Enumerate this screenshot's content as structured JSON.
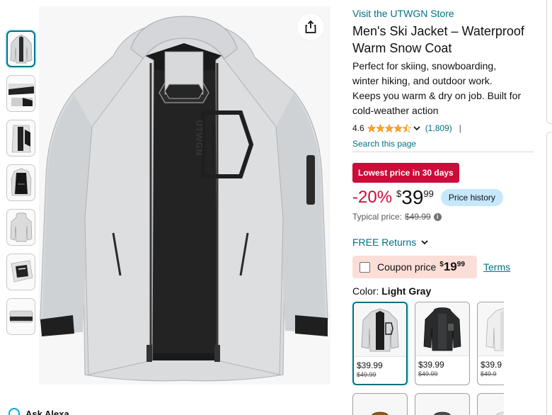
{
  "product": {
    "store_link": "Visit the UTWGN Store",
    "title": "Men's Ski Jacket – Waterproof Warm Snow Coat",
    "description": "Perfect for skiing, snowboarding, winter hiking, and outdoor work. Keeps you warm & dry on job. Built for cold-weather action",
    "rating": "4.6",
    "rating_count": "(1,809)",
    "rating_separator": "|",
    "search_link": "Search this page",
    "brand_print": "UTWGN",
    "image_icons": [
      "jacket-image",
      "share-icon"
    ]
  },
  "gallery": {
    "thumbnail_count": 7,
    "active_index": 0
  },
  "pricing": {
    "deal_badge": "Lowest price in 30 days",
    "discount": "-20%",
    "currency": "$",
    "price_whole": "39",
    "price_fraction": "99",
    "price_history_label": "Price history",
    "typical_label": "Typical price:",
    "typical_price": "$49.99"
  },
  "returns": {
    "label": "FREE Returns"
  },
  "coupon": {
    "label": "Coupon price",
    "currency": "$",
    "whole": "19",
    "fraction": "99",
    "terms_label": "Terms"
  },
  "color": {
    "label": "Color:",
    "selected": "Light Gray",
    "options": [
      {
        "price": "$39.99",
        "old_price": "$49.99"
      },
      {
        "price": "$39.99",
        "old_price": "$49.99"
      },
      {
        "price": "$39.9",
        "old_price": "$49.9"
      }
    ]
  },
  "alexa": {
    "label": "Ask Alexa"
  },
  "colors": {
    "link": "#007185",
    "deal_red": "#CC0C39",
    "star": "#FFA41C",
    "price_history_bg": "#c7e7fb",
    "coupon_bg": "#fcded8"
  }
}
